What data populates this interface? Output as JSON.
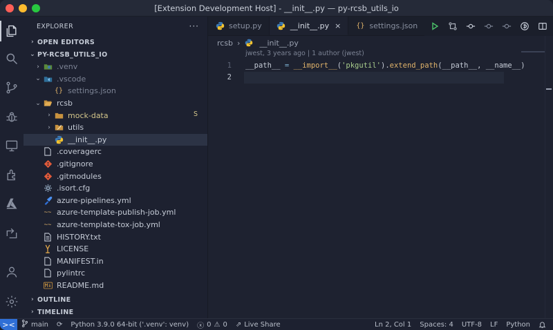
{
  "window": {
    "title": "[Extension Development Host] - __init__.py — py-rcsb_utils_io"
  },
  "activity_bar": {
    "items": [
      "explorer-icon",
      "search-icon",
      "source-control-icon",
      "run-debug-icon",
      "remote-explorer-icon",
      "extensions-icon",
      "azure-icon",
      "live-share-icon",
      "accounts-icon",
      "manage-gear-icon"
    ]
  },
  "sidebar": {
    "header": "EXPLORER",
    "more": "···",
    "sections": {
      "open_editors": "OPEN EDITORS",
      "project": "PY-RCSB_UTILS_IO",
      "outline": "OUTLINE",
      "timeline": "TIMELINE"
    },
    "tree": [
      {
        "label": ".venv",
        "icon": "venv-folder-icon",
        "chevron": "›",
        "indent": 1,
        "dim": true
      },
      {
        "label": ".vscode",
        "icon": "vscode-folder-icon",
        "chevron": "⌄",
        "indent": 1,
        "dim": true
      },
      {
        "label": "settings.json",
        "icon": "json-icon",
        "chevron": "",
        "indent": 2,
        "dim": true
      },
      {
        "label": "rcsb",
        "icon": "folder-open-icon",
        "chevron": "⌄",
        "indent": 1
      },
      {
        "label": "mock-data",
        "icon": "folder-icon",
        "chevron": "›",
        "indent": 2,
        "modified": true,
        "badge": "S"
      },
      {
        "label": "utils",
        "icon": "utils-folder-icon",
        "chevron": "›",
        "indent": 2
      },
      {
        "label": "__init__.py",
        "icon": "python-icon",
        "chevron": "",
        "indent": 2,
        "selected": true
      },
      {
        "label": ".coveragerc",
        "icon": "file-icon",
        "chevron": "",
        "indent": 1
      },
      {
        "label": ".gitignore",
        "icon": "git-icon",
        "chevron": "",
        "indent": 1
      },
      {
        "label": ".gitmodules",
        "icon": "git-icon",
        "chevron": "",
        "indent": 1
      },
      {
        "label": ".isort.cfg",
        "icon": "gear-icon",
        "chevron": "",
        "indent": 1
      },
      {
        "label": "azure-pipelines.yml",
        "icon": "azure-pipelines-icon",
        "chevron": "",
        "indent": 1
      },
      {
        "label": "azure-template-publish-job.yml",
        "icon": "yaml-icon",
        "chevron": "",
        "indent": 1
      },
      {
        "label": "azure-template-tox-job.yml",
        "icon": "yaml-icon",
        "chevron": "",
        "indent": 1
      },
      {
        "label": "HISTORY.txt",
        "icon": "text-file-icon",
        "chevron": "",
        "indent": 1
      },
      {
        "label": "LICENSE",
        "icon": "license-icon",
        "chevron": "",
        "indent": 1
      },
      {
        "label": "MANIFEST.in",
        "icon": "file-icon",
        "chevron": "",
        "indent": 1
      },
      {
        "label": "pylintrc",
        "icon": "file-icon",
        "chevron": "",
        "indent": 1
      },
      {
        "label": "README.md",
        "icon": "markdown-icon",
        "chevron": "",
        "indent": 1
      }
    ]
  },
  "editor": {
    "tabs": [
      {
        "label": "setup.py",
        "icon": "python-icon",
        "active": false
      },
      {
        "label": "__init__.py",
        "icon": "python-icon",
        "active": true,
        "close": "×"
      },
      {
        "label": "settings.json",
        "icon": "json-icon",
        "active": false
      }
    ],
    "breadcrumb": {
      "folder": "rcsb",
      "separator": "›",
      "file": "__init__.py"
    },
    "blame": "jwest, 3 years ago | 1 author (jwest)",
    "lines": [
      {
        "number": "1",
        "tokens": [
          {
            "t": "__path__",
            "c": "tok-attr"
          },
          {
            "t": " = ",
            "c": "tok-op"
          },
          {
            "t": "__import__",
            "c": "tok-func"
          },
          {
            "t": "(",
            "c": "tok-p"
          },
          {
            "t": "'pkgutil'",
            "c": "tok-str"
          },
          {
            "t": ").",
            "c": "tok-p"
          },
          {
            "t": "extend_path",
            "c": "tok-func"
          },
          {
            "t": "(__path__, __name__)",
            "c": "tok-p"
          }
        ]
      },
      {
        "number": "2",
        "tokens": []
      }
    ]
  },
  "status_bar": {
    "remote": "><",
    "branch": "main",
    "sync": "⟳",
    "interpreter": "Python 3.9.0 64-bit ('.venv': venv)",
    "errors": "0",
    "warnings": "0",
    "live_share": "Live Share",
    "cursor": "Ln 2, Col 1",
    "spaces": "Spaces: 4",
    "encoding": "UTF-8",
    "eol": "LF",
    "language": "Python",
    "bell": "🔔"
  }
}
